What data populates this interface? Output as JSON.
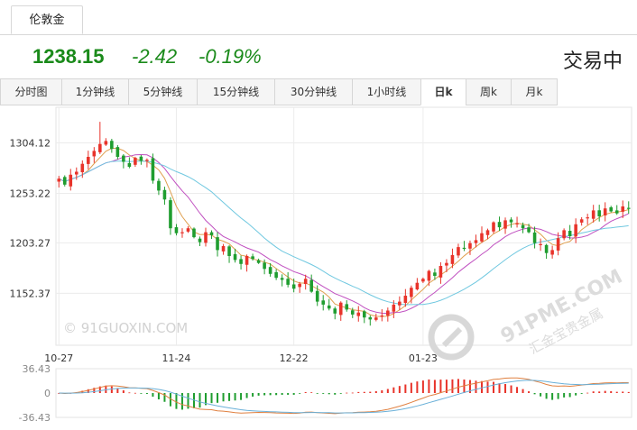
{
  "top_tab": {
    "label": "伦敦金"
  },
  "quote": {
    "price": "1238.15",
    "change": "-2.42",
    "change_pct": "-0.19%",
    "status": "交易中"
  },
  "period_tabs": [
    {
      "label": "分时图",
      "active": false
    },
    {
      "label": "1分钟线",
      "active": false
    },
    {
      "label": "5分钟线",
      "active": false
    },
    {
      "label": "15分钟线",
      "active": false
    },
    {
      "label": "30分钟线",
      "active": false
    },
    {
      "label": "1小时线",
      "active": false
    },
    {
      "label": "日k",
      "active": true
    },
    {
      "label": "周k",
      "active": false
    },
    {
      "label": "月k",
      "active": false
    }
  ],
  "watermarks": {
    "left": "© 91GUOXIN.COM",
    "right_en": "91PME.COM",
    "right_cn": "汇金宝贵金属"
  },
  "colors": {
    "up": "#e8332a",
    "down": "#1f9d2f",
    "ma5": "#e0a050",
    "ma10": "#c050c0",
    "ma20": "#70c8e0",
    "macd_dif": "#e08040",
    "macd_dea": "#6ab0d8"
  },
  "chart_data": {
    "type": "candlestick",
    "y_ticks": [
      "1304.12",
      "1253.22",
      "1203.27",
      "1152.37"
    ],
    "y_tick_values": [
      1304.12,
      1253.22,
      1203.27,
      1152.37
    ],
    "ylim": [
      1100,
      1340
    ],
    "x_ticks": [
      {
        "label": "10-27",
        "index": 0
      },
      {
        "label": "11-24",
        "index": 20
      },
      {
        "label": "12-22",
        "index": 40
      },
      {
        "label": "01-23",
        "index": 62
      }
    ],
    "indicator": {
      "type": "macd",
      "y_ticks": [
        "36.43",
        "0",
        "-36.43"
      ],
      "ylim": [
        -36.43,
        36.43
      ]
    },
    "close": [
      1268,
      1262,
      1272,
      1275,
      1283,
      1290,
      1296,
      1303,
      1306,
      1298,
      1290,
      1285,
      1280,
      1289,
      1286,
      1287,
      1266,
      1256,
      1247,
      1218,
      1213,
      1214,
      1218,
      1209,
      1204,
      1214,
      1211,
      1196,
      1200,
      1190,
      1186,
      1182,
      1190,
      1187,
      1183,
      1177,
      1172,
      1168,
      1166,
      1161,
      1157,
      1162,
      1167,
      1154,
      1144,
      1141,
      1137,
      1132,
      1143,
      1136,
      1131,
      1133,
      1128,
      1126,
      1128,
      1130,
      1135,
      1141,
      1144,
      1150,
      1158,
      1163,
      1167,
      1175,
      1170,
      1180,
      1183,
      1191,
      1199,
      1198,
      1203,
      1206,
      1213,
      1216,
      1224,
      1219,
      1226,
      1224,
      1223,
      1218,
      1214,
      1203,
      1202,
      1193,
      1196,
      1208,
      1216,
      1210,
      1222,
      1227,
      1229,
      1236,
      1230,
      1238,
      1235,
      1233,
      1240,
      1238
    ]
  }
}
